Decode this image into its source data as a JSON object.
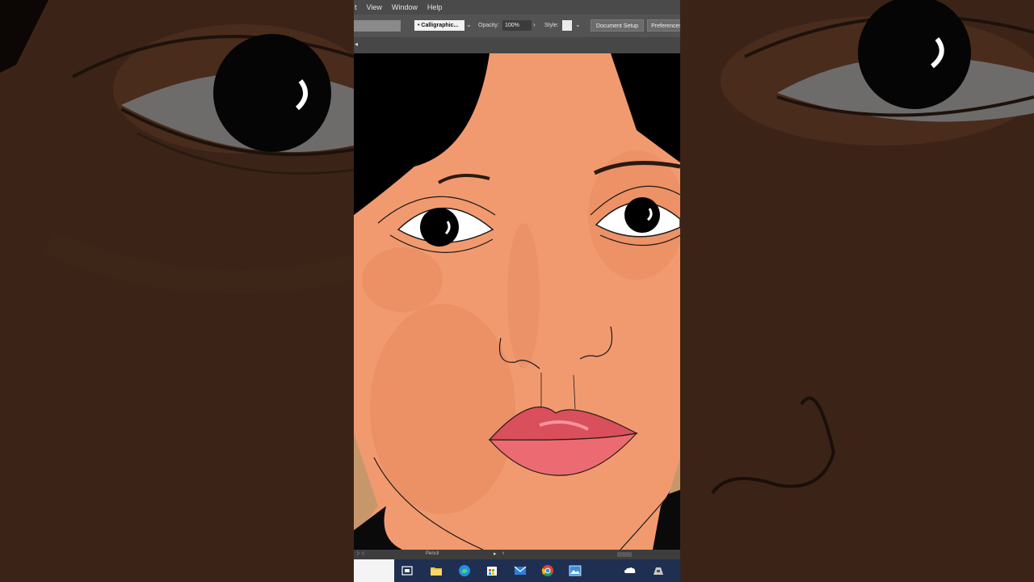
{
  "menu": {
    "items": [
      "t",
      "View",
      "Window",
      "Help"
    ]
  },
  "control_bar": {
    "brush_label": "Calligraphic...",
    "opacity_label": "Opacity:",
    "opacity_value": "100%",
    "style_label": "Style:",
    "document_setup_label": "Document Setup",
    "preferences_label": "Preferences"
  },
  "status_bar": {
    "tool_label": "Pencil"
  },
  "taskbar": {
    "icons": [
      "task-view-icon",
      "file-explorer-icon",
      "edge-browser-icon",
      "store-icon",
      "mail-icon",
      "chrome-icon",
      "photos-icon",
      "onedrive-icon",
      "network-icon"
    ]
  },
  "colors": {
    "skin": "#f29a6f",
    "hair": "#000000",
    "lips": "#e45a63",
    "ui_dark": "#535353",
    "taskbar": "#1f2f52",
    "background": "#3a2418"
  }
}
